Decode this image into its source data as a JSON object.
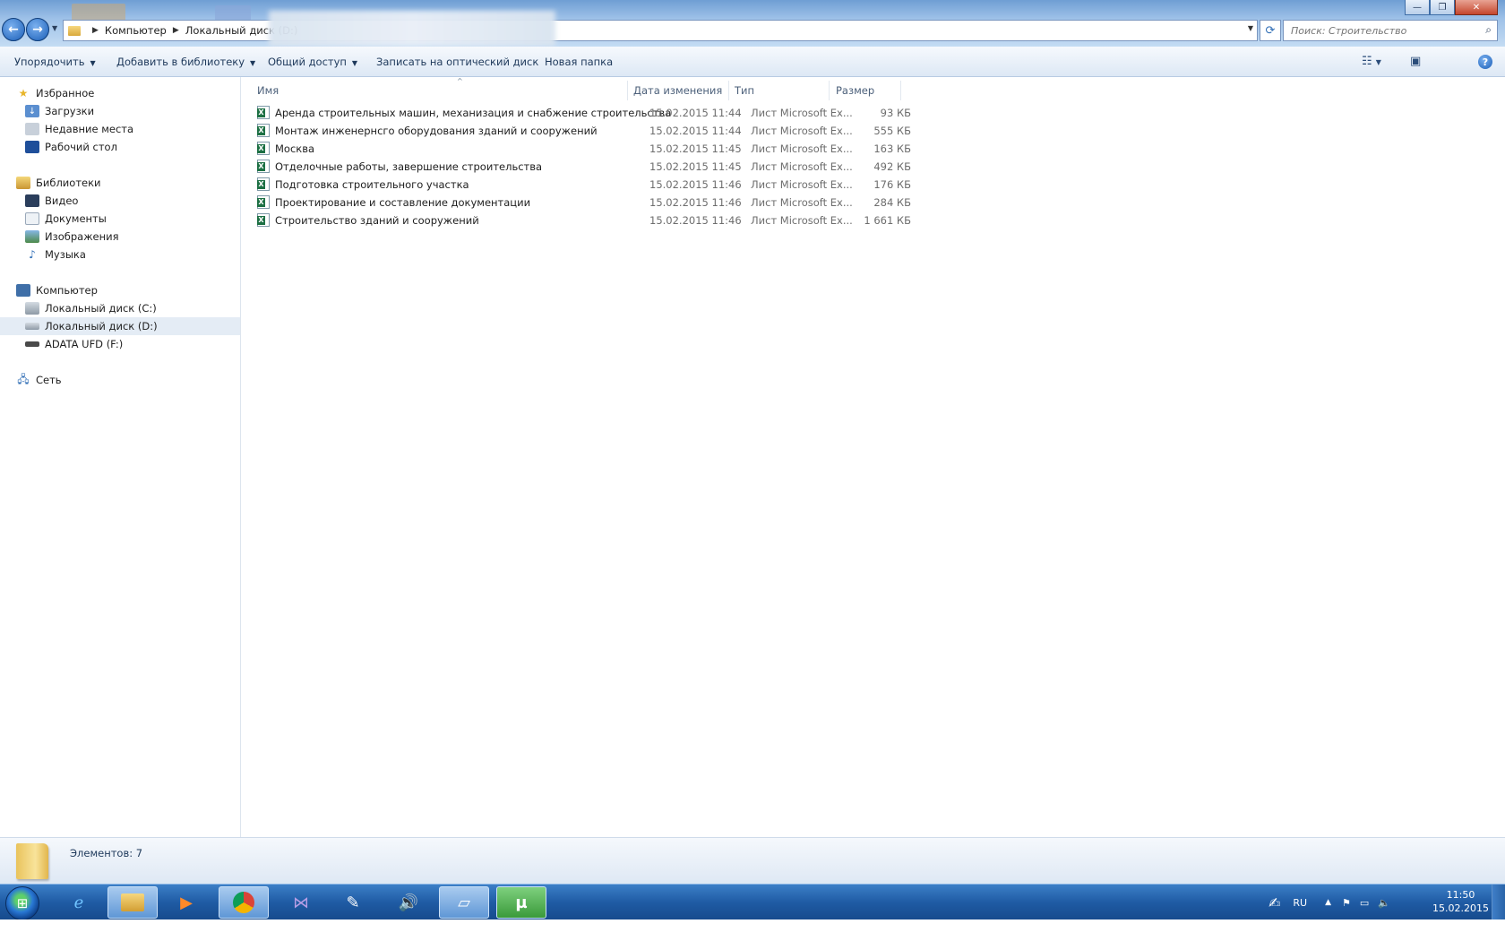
{
  "window": {
    "nav": {
      "back_label": "←",
      "forward_label": "→"
    },
    "breadcrumb": [
      "Компьютер",
      "Локальный диск (D:)"
    ],
    "search_placeholder": "Поиск: Строительство",
    "controls": {
      "minimize": "—",
      "maximize": "❐",
      "close": "✕"
    }
  },
  "toolbar": {
    "organize": "Упорядочить",
    "add_to_library": "Добавить в библиотеку",
    "share": "Общий доступ",
    "burn": "Записать на оптический диск",
    "new_folder": "Новая папка"
  },
  "sidebar": {
    "favorites": {
      "title": "Избранное",
      "items": [
        "Загрузки",
        "Недавние места",
        "Рабочий стол"
      ]
    },
    "libraries": {
      "title": "Библиотеки",
      "items": [
        "Видео",
        "Документы",
        "Изображения",
        "Музыка"
      ]
    },
    "computer": {
      "title": "Компьютер",
      "items": [
        "Локальный диск (C:)",
        "Локальный диск (D:)",
        "ADATA UFD (F:)"
      ]
    },
    "network": {
      "title": "Сеть"
    }
  },
  "columns": {
    "name": "Имя",
    "date": "Дата изменения",
    "type": "Тип",
    "size": "Размер"
  },
  "files": [
    {
      "name": "Аренда строительных машин, механизация и снабжение строительства",
      "date": "15.02.2015 11:44",
      "type": "Лист Microsoft Ex...",
      "size": "93 КБ"
    },
    {
      "name": "Монтаж инженернсго оборудования зданий и сооружений",
      "date": "15.02.2015 11:44",
      "type": "Лист Microsoft Ex...",
      "size": "555 КБ"
    },
    {
      "name": "Москва",
      "date": "15.02.2015 11:45",
      "type": "Лист Microsoft Ex...",
      "size": "163 КБ"
    },
    {
      "name": "Отделочные работы, завершение строительства",
      "date": "15.02.2015 11:45",
      "type": "Лист Microsoft Ex...",
      "size": "492 КБ"
    },
    {
      "name": "Подготовка строительного участка",
      "date": "15.02.2015 11:46",
      "type": "Лист Microsoft Ex...",
      "size": "176 КБ"
    },
    {
      "name": "Проектирование и составление документации",
      "date": "15.02.2015 11:46",
      "type": "Лист Microsoft Ex...",
      "size": "284 КБ"
    },
    {
      "name": "Строительство зданий и сооружений",
      "date": "15.02.2015 11:46",
      "type": "Лист Microsoft Ex...",
      "size": "1 661 КБ"
    }
  ],
  "details": {
    "item_count": "Элементов: 7"
  },
  "taskbar": {
    "language": "RU",
    "time": "11:50",
    "date": "15.02.2015",
    "apps": [
      "internet-explorer",
      "explorer",
      "media-player",
      "chrome",
      "visual-studio",
      "notepad",
      "audio",
      "app",
      "utorrent"
    ]
  },
  "colors": {
    "accent": "#1f5ba4",
    "selected": "#e4ecf5",
    "excel": "#1d7044"
  }
}
